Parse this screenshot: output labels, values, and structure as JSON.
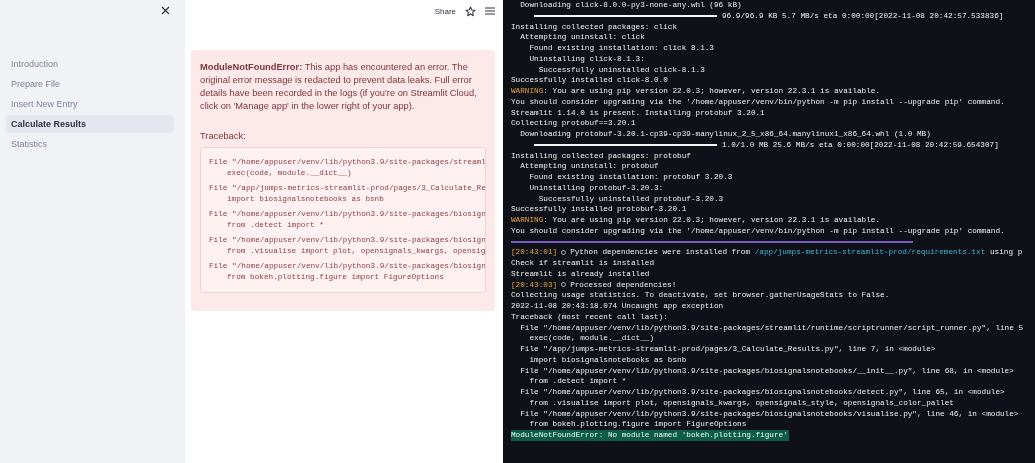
{
  "sidebar": {
    "items": [
      {
        "label": "Introduction",
        "selected": false
      },
      {
        "label": "Prepare File",
        "selected": false
      },
      {
        "label": "Insert New Entry",
        "selected": false
      },
      {
        "label": "Calculate Results",
        "selected": true
      },
      {
        "label": "Statistics",
        "selected": false
      }
    ]
  },
  "header": {
    "share": "Share"
  },
  "error": {
    "message": "**ModuleNotFoundError:** This app has encountered an error. The original error message is redacted to prevent data leaks. Full error details have been recorded in the logs (if you're on Streamlit Cloud, click on 'Manage app' in the lower right of your app).",
    "traceback_label": "Traceback:",
    "traceback": [
      {
        "file": "File \"/home/appuser/venv/lib/python3.9/site-packages/streaml",
        "code": "exec(code, module.__dict__)"
      },
      {
        "file": "File \"/app/jumps-metrics-streamlit-prod/pages/3_Calculate_Re",
        "code": "import biosignalsnotebooks as bsnb"
      },
      {
        "file": "File \"/home/appuser/venv/lib/python3.9/site-packages/biosign",
        "code": "from .detect import *"
      },
      {
        "file": "File \"/home/appuser/venv/lib/python3.9/site-packages/biosign",
        "code": "from .visualise import plot, opensignals_kwargs, opensig"
      },
      {
        "file": "File \"/home/appuser/venv/lib/python3.9/site-packages/biosign",
        "code": "from bokeh.plotting.figure import FigureOptions"
      }
    ]
  },
  "terminal": {
    "lines": [
      {
        "kind": "plain",
        "text": "  Downloading click-8.0.0-py3-none-any.whl (96 kB)"
      },
      {
        "kind": "progress",
        "level": 1,
        "text": "96.9/96.9 KB 5.7 MB/s eta 0:00:00[2022-11-08 20:42:57.533836]"
      },
      {
        "kind": "plain",
        "text": "Installing collected packages: click"
      },
      {
        "kind": "plain",
        "text": "  Attempting uninstall: click"
      },
      {
        "kind": "plain",
        "text": "    Found existing installation: click 8.1.3"
      },
      {
        "kind": "plain",
        "text": "    Uninstalling click-8.1.3:"
      },
      {
        "kind": "plain",
        "text": "      Successfully uninstalled click-8.1.3"
      },
      {
        "kind": "plain",
        "text": "Successfully installed click-8.0.0"
      },
      {
        "kind": "warning",
        "label": "WARNING",
        "text": ": You are using pip version 22.0.3; however, version 22.3.1 is available."
      },
      {
        "kind": "plain",
        "text": "You should consider upgrading via the '/home/appuser/venv/bin/python -m pip install --upgrade pip' command."
      },
      {
        "kind": "plain",
        "text": "Streamlit 1.14.0 is present. Installing protobuf 3.20.1"
      },
      {
        "kind": "plain",
        "text": "Collecting protobuf==3.20.1"
      },
      {
        "kind": "plain",
        "text": "  Downloading protobuf-3.20.1-cp39-cp39-manylinux_2_5_x86_64.manylinux1_x86_64.whl (1.0 MB)"
      },
      {
        "kind": "progress",
        "level": 1,
        "text": "1.0/1.0 MB 25.6 MB/s eta 0:00:00[2022-11-08 20:42:59.654307]"
      },
      {
        "kind": "plain",
        "text": "Installing collected packages: protobuf"
      },
      {
        "kind": "plain",
        "text": "  Attempting uninstall: protobuf"
      },
      {
        "kind": "plain",
        "text": "    Found existing installation: protobuf 3.20.3"
      },
      {
        "kind": "plain",
        "text": "    Uninstalling protobuf-3.20.3:"
      },
      {
        "kind": "plain",
        "text": "      Successfully uninstalled protobuf-3.20.3"
      },
      {
        "kind": "plain",
        "text": "Successfully installed protobuf-3.20.1"
      },
      {
        "kind": "warning",
        "label": "WARNING",
        "text": ": You are using pip version 22.0.3; however, version 22.3.1 is available."
      },
      {
        "kind": "plain",
        "text": "You should consider upgrading via the '/home/appuser/venv/bin/python -m pip install --upgrade pip' command."
      },
      {
        "kind": "separator"
      },
      {
        "kind": "log",
        "time": "[20:43:01]",
        "text": "Python dependencies were installed from",
        "path": "/app/jumps-metrics-streamlit-prod/requirements.txt",
        "rest": "using p"
      },
      {
        "kind": "plain",
        "text": "Check if streamlit is installed"
      },
      {
        "kind": "plain",
        "text": "Streamlit is already installed"
      },
      {
        "kind": "log",
        "time": "[20:43:03]",
        "text": "Processed dependencies!"
      },
      {
        "kind": "plain",
        "text": "Collecting usage statistics. To deactivate, set browser.gatherUsageStats to False."
      },
      {
        "kind": "plain",
        "text": "2022-11-08 20:43:18.074 Uncaught app exception"
      },
      {
        "kind": "plain",
        "text": "Traceback (most recent call last):"
      },
      {
        "kind": "plain",
        "text": "  File \"/home/appuser/venv/lib/python3.9/site-packages/streamlit/runtime/scriptrunner/script_runner.py\", line 5"
      },
      {
        "kind": "plain",
        "text": "    exec(code, module.__dict__)"
      },
      {
        "kind": "plain",
        "text": "  File \"/app/jumps-metrics-streamlit-prod/pages/3_Calculate_Results.py\", line 7, in <module>"
      },
      {
        "kind": "plain",
        "text": "    import biosignalsnotebooks as bsnb"
      },
      {
        "kind": "plain",
        "text": "  File \"/home/appuser/venv/lib/python3.9/site-packages/biosignalsnotebooks/__init__.py\", line 68, in <module>"
      },
      {
        "kind": "plain",
        "text": "    from .detect import *"
      },
      {
        "kind": "plain",
        "text": "  File \"/home/appuser/venv/lib/python3.9/site-packages/biosignalsnotebooks/detect.py\", line 65, in <module>"
      },
      {
        "kind": "plain",
        "text": "    from .visualise import plot, opensignals_kwargs, opensignals_style, opensignals_color_pallet"
      },
      {
        "kind": "plain",
        "text": "  File \"/home/appuser/venv/lib/python3.9/site-packages/biosignalsnotebooks/visualise.py\", line 46, in <module>"
      },
      {
        "kind": "plain",
        "text": "    from bokeh.plotting.figure import FigureOptions"
      },
      {
        "kind": "error",
        "text": "ModuleNotFoundError: No module named 'bokeh.plotting.figure'"
      }
    ]
  }
}
